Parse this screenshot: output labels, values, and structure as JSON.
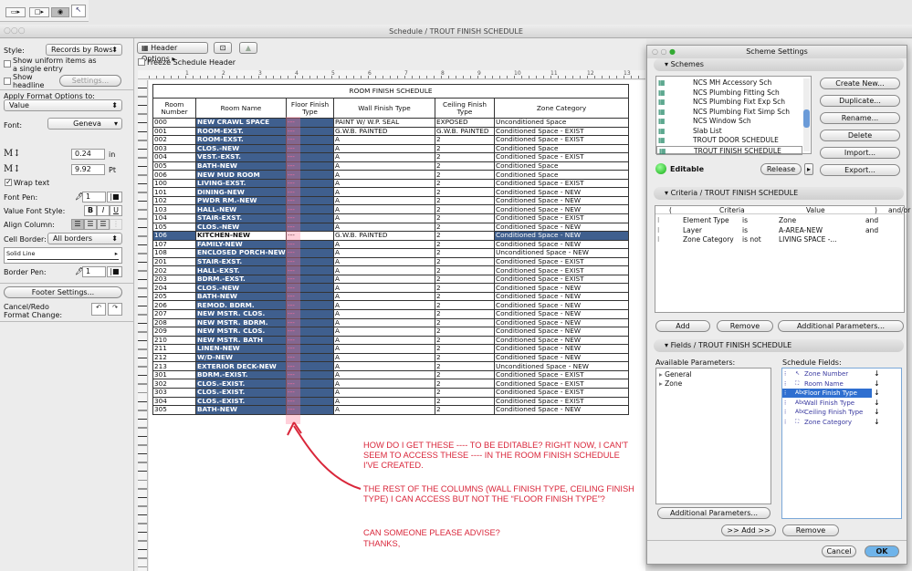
{
  "window": {
    "title": "Schedule /  TROUT FINISH SCHEDULE"
  },
  "left": {
    "style_label": "Style:",
    "style_value": "Records by Rows",
    "uniform_label": "Show uniform items as a single entry",
    "headline_label": "Show headline",
    "settings_button": "Settings...",
    "apply_label": "Apply Format Options to:",
    "apply_value": "Value",
    "font_label": "Font:",
    "font_value": "Geneva",
    "height_value": "0.24",
    "height_unit": "in",
    "size_value": "9.92",
    "size_unit": "Pt",
    "wrap_label": "Wrap text",
    "wrap_checked": true,
    "font_pen_label": "Font Pen:",
    "font_pen_value": "1",
    "value_style_label": "Value Font Style:",
    "bold": "B",
    "italic": "I",
    "underline": "U",
    "align_label": "Align Column:",
    "cell_border_label": "Cell Border:",
    "cell_border_value": "All borders",
    "line_value": "Solid Line",
    "border_pen_label": "Border Pen:",
    "border_pen_value": "1",
    "footer_button": "Footer Settings...",
    "cancel_redo_label": "Cancel/Redo Format Change:"
  },
  "toolbar": {
    "header_options": "Header Options",
    "freeze_label": "Freeze Schedule Header"
  },
  "ruler": [
    "1",
    "2",
    "3",
    "4",
    "5",
    "6",
    "7",
    "8",
    "9",
    "10",
    "11",
    "12",
    "13"
  ],
  "schedule": {
    "title": "ROOM FINISH SCHEDULE",
    "headers": [
      "Room Number",
      "Room Name",
      "Floor Finish Type",
      "Wall Finish Type",
      "Ceiling Finish Type",
      "Zone Category"
    ],
    "current_row": "106",
    "rows": [
      [
        "000",
        "NEW CRAWL SPACE",
        "---",
        "PAINT W/ W.P. SEAL",
        "EXPOSED",
        "Unconditioned Space"
      ],
      [
        "001",
        "ROOM-EXST.",
        "---",
        "G.W.B. PAINTED",
        "G.W.B. PAINTED",
        "Conditioned Space - EXIST"
      ],
      [
        "002",
        "ROOM-EXST.",
        "---",
        "A",
        "2",
        "Conditioned Space - EXIST"
      ],
      [
        "003",
        "CLOS.-NEW",
        "---",
        "A",
        "2",
        "Conditioned Space"
      ],
      [
        "004",
        "VEST.-EXST.",
        "---",
        "A",
        "2",
        "Conditioned Space - EXIST"
      ],
      [
        "005",
        "BATH-NEW",
        "---",
        "A",
        "2",
        "Conditioned Space"
      ],
      [
        "006",
        "NEW MUD ROOM",
        "---",
        "A",
        "2",
        "Conditioned Space"
      ],
      [
        "100",
        "LIVING-EXST.",
        "---",
        "A",
        "2",
        "Conditioned Space - EXIST"
      ],
      [
        "101",
        "DINING-NEW",
        "---",
        "A",
        "2",
        "Conditioned Space - NEW"
      ],
      [
        "102",
        "PWDR RM.-NEW",
        "---",
        "A",
        "2",
        "Conditioned Space - NEW"
      ],
      [
        "103",
        "HALL-NEW",
        "---",
        "A",
        "2",
        "Conditioned Space - NEW"
      ],
      [
        "104",
        "STAIR-EXST.",
        "---",
        "A",
        "2",
        "Conditioned Space - EXIST"
      ],
      [
        "105",
        "CLOS.-NEW",
        "---",
        "A",
        "2",
        "Conditioned Space - NEW"
      ],
      [
        "106",
        "KITCHEN-NEW",
        "---",
        "G.W.B. PAINTED",
        "2",
        "Conditioned Space - NEW"
      ],
      [
        "107",
        "FAMILY-NEW",
        "---",
        "A",
        "2",
        "Conditioned Space - NEW"
      ],
      [
        "108",
        "ENCLOSED PORCH-NEW",
        "---",
        "A",
        "2",
        "Unconditioned Space - NEW"
      ],
      [
        "201",
        "STAIR-EXST.",
        "---",
        "A",
        "2",
        "Conditioned Space - EXIST"
      ],
      [
        "202",
        "HALL-EXST.",
        "---",
        "A",
        "2",
        "Conditioned Space - EXIST"
      ],
      [
        "203",
        "BDRM.-EXST.",
        "---",
        "A",
        "2",
        "Conditioned Space - EXIST"
      ],
      [
        "204",
        "CLOS.-NEW",
        "---",
        "A",
        "2",
        "Conditioned Space - NEW"
      ],
      [
        "205",
        "BATH-NEW",
        "---",
        "A",
        "2",
        "Conditioned Space - NEW"
      ],
      [
        "206",
        "REMOD. BDRM.",
        "---",
        "A",
        "2",
        "Conditioned Space - NEW"
      ],
      [
        "207",
        "NEW MSTR. CLOS.",
        "---",
        "A",
        "2",
        "Conditioned Space - NEW"
      ],
      [
        "208",
        "NEW MSTR. BDRM.",
        "---",
        "A",
        "2",
        "Conditioned Space - NEW"
      ],
      [
        "209",
        "NEW MSTR. CLOS.",
        "---",
        "A",
        "2",
        "Conditioned Space - NEW"
      ],
      [
        "210",
        "NEW MSTR. BATH",
        "---",
        "A",
        "2",
        "Conditioned Space - NEW"
      ],
      [
        "211",
        "LINEN-NEW",
        "---",
        "A",
        "2",
        "Conditioned Space - NEW"
      ],
      [
        "212",
        "W/D-NEW",
        "---",
        "A",
        "2",
        "Conditioned Space - NEW"
      ],
      [
        "213",
        "EXTERIOR DECK-NEW",
        "---",
        "A",
        "2",
        "Unconditioned Space - NEW"
      ],
      [
        "301",
        "BDRM.-EXIST.",
        "---",
        "A",
        "2",
        "Conditioned Space - EXIST"
      ],
      [
        "302",
        "CLOS.-EXIST.",
        "---",
        "A",
        "2",
        "Conditioned Space - EXIST"
      ],
      [
        "303",
        "CLOS.-EXIST.",
        "---",
        "A",
        "2",
        "Conditioned Space - EXIST"
      ],
      [
        "304",
        "CLOS.-EXIST.",
        "---",
        "A",
        "2",
        "Conditioned Space - EXIST"
      ],
      [
        "305",
        "BATH-NEW",
        "---",
        "A",
        "2",
        "Conditioned Space - NEW"
      ]
    ]
  },
  "annotation": {
    "p1": "HOW DO I GET THESE ---- TO BE EDITABLE? RIGHT NOW, I CAN'T SEEM TO ACCESS THESE ---- IN THE ROOM FINISH SCHEDULE I'VE CREATED.",
    "p2": "THE REST OF THE COLUMNS (WALL FINISH TYPE, CEILING FINISH TYPE) I CAN ACCESS BUT NOT THE “FLOOR FINISH TYPE”?",
    "p3": "CAN SOMEONE PLEASE ADVISE?",
    "p4": "THANKS,",
    "color": "#d9263a"
  },
  "dialog": {
    "title": "Scheme Settings",
    "schemes_label": "Schemes",
    "schemes": [
      "NCS MH Accessory Sch",
      "NCS Plumbing Fitting Sch",
      "NCS Plumbing Fixt Exp Sch",
      "NCS Plumbing Fixt Simp Sch",
      "NCS Window Sch",
      "Slab List",
      "TROUT DOOR SCHEDULE",
      "TROUT FINISH SCHEDULE"
    ],
    "scheme_buttons": [
      "Create New...",
      "Duplicate...",
      "Rename...",
      "Delete",
      "Import...",
      "Export..."
    ],
    "editable": "Editable",
    "release": "Release",
    "criteria_label": "Criteria /  TROUT FINISH SCHEDULE",
    "criteria_headers": [
      "(",
      "Criteria",
      "Value",
      ")",
      "and/or"
    ],
    "criteria": [
      [
        "Element Type",
        "is",
        "Zone",
        "and"
      ],
      [
        "Layer",
        "is",
        "A-AREA-NEW",
        "and"
      ],
      [
        "Zone Category",
        "is not",
        "LIVING SPACE -...",
        ""
      ]
    ],
    "criteria_buttons": [
      "Add",
      "Remove",
      "Additional Parameters..."
    ],
    "fields_label": "Fields /  TROUT FINISH SCHEDULE",
    "available_label": "Available Parameters:",
    "available": [
      "General",
      "Zone"
    ],
    "schedule_fields_label": "Schedule Fields:",
    "schedule_fields": [
      "Zone Number",
      "Room Name",
      "Floor Finish Type",
      "Wall Finish Type",
      "Ceiling Finish Type",
      "Zone Category"
    ],
    "selected_field": "Floor Finish Type",
    "additional_button": "Additional Parameters...",
    "add_button": ">> Add >>",
    "remove_button": "Remove",
    "cancel": "Cancel",
    "ok": "OK",
    "ok_color": "#6fb4ea"
  }
}
